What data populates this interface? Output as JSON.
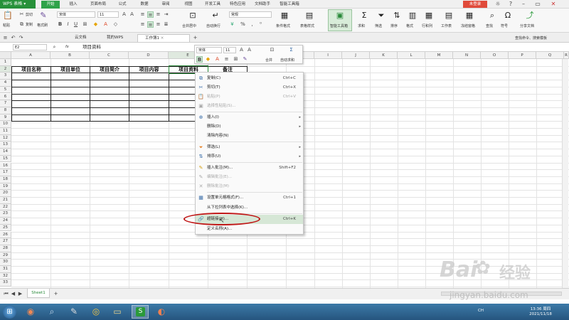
{
  "titlebar": {
    "app_name": "WPS 表格",
    "tabs": [
      "开始",
      "插入",
      "页面布局",
      "公式",
      "数据",
      "审阅",
      "视图",
      "开发工具",
      "特色应用",
      "文档助手",
      "智能工具箱"
    ],
    "active_tab": "开始",
    "login": "未登录"
  },
  "ribbon": {
    "cut": "剪切",
    "copy": "复制",
    "paste": "粘贴",
    "format_painter": "格式刷",
    "font_name": "宋体",
    "font_size": "11",
    "merge_center": "合并居中",
    "wrap_text": "自动换行",
    "number_format": "常规",
    "percent": "%",
    "cond_format": "条件格式",
    "table_style": "表格样式",
    "smart_toolbox": "智能工具箱",
    "sum": "求和",
    "filter": "筛选",
    "sort": "排序",
    "format": "格式",
    "row_col": "行和列",
    "worksheet": "工作表",
    "freeze": "冻结窗格",
    "find": "查找",
    "symbol": "符号",
    "share": "分享文档",
    "command_search": "查找命令、搜索模板"
  },
  "doctabs": {
    "tabs": [
      "云文档",
      "我的WPS",
      "工作簿1"
    ],
    "active": "工作簿1"
  },
  "formula_bar": {
    "cell_ref": "E2",
    "fx": "fx",
    "content": "项目资料"
  },
  "grid": {
    "columns": [
      "A",
      "B",
      "C",
      "D",
      "E",
      "F",
      "G",
      "H",
      "I",
      "J",
      "K",
      "L",
      "M",
      "N",
      "O",
      "P",
      "Q",
      "R"
    ],
    "rows": [
      "1",
      "2",
      "3",
      "4",
      "5",
      "6",
      "7",
      "8",
      "9",
      "10",
      "11",
      "12",
      "13",
      "14",
      "15",
      "16",
      "17",
      "18",
      "19",
      "20",
      "21",
      "22",
      "23",
      "24",
      "25",
      "26",
      "27",
      "28",
      "29",
      "30",
      "31",
      "32",
      "33"
    ],
    "headers": [
      "项目名称",
      "项目单位",
      "项目简介",
      "项目内容",
      "项目资料",
      "备注"
    ]
  },
  "minibar": {
    "font_name": "宋体",
    "font_size": "11",
    "merge": "合并",
    "autosum": "自动求和"
  },
  "context_menu": {
    "items": [
      {
        "label": "复制(C)",
        "shortcut": "Ctrl+C",
        "icon": "copy-icon",
        "disabled": false
      },
      {
        "label": "剪切(T)",
        "shortcut": "Ctrl+X",
        "icon": "cut-icon",
        "disabled": false
      },
      {
        "label": "粘贴(P)",
        "shortcut": "Ctrl+V",
        "icon": "paste-icon",
        "disabled": true
      },
      {
        "label": "选择性粘贴(S)...",
        "shortcut": "",
        "icon": "paste-special-icon",
        "disabled": true
      },
      {
        "label": "插入(I)",
        "shortcut": "",
        "icon": "insert-icon",
        "disabled": false,
        "submenu": true
      },
      {
        "label": "删除(D)",
        "shortcut": "",
        "icon": "",
        "disabled": false,
        "submenu": true
      },
      {
        "label": "清除内容(N)",
        "shortcut": "",
        "icon": "",
        "disabled": false
      },
      {
        "label": "筛选(L)",
        "shortcut": "",
        "icon": "filter-icon",
        "disabled": false,
        "submenu": true
      },
      {
        "label": "排序(U)",
        "shortcut": "",
        "icon": "sort-icon",
        "disabled": false,
        "submenu": true
      },
      {
        "label": "插入批注(M)...",
        "shortcut": "Shift+F2",
        "icon": "comment-icon",
        "disabled": false
      },
      {
        "label": "编辑批注(E)...",
        "shortcut": "",
        "icon": "edit-comment-icon",
        "disabled": true
      },
      {
        "label": "删除批注(M)",
        "shortcut": "",
        "icon": "delete-comment-icon",
        "disabled": true
      },
      {
        "label": "设置单元格格式(F)...",
        "shortcut": "Ctrl+1",
        "icon": "format-cells-icon",
        "disabled": false
      },
      {
        "label": "从下拉列表中选择(K)...",
        "shortcut": "",
        "icon": "",
        "disabled": false
      },
      {
        "label": "超链接(H)...",
        "shortcut": "Ctrl+K",
        "icon": "hyperlink-icon",
        "disabled": false,
        "highlighted": true
      },
      {
        "label": "定义名称(A)...",
        "shortcut": "",
        "icon": "",
        "disabled": false
      }
    ]
  },
  "sheet_tabs": {
    "active": "Sheet1",
    "add": "+"
  },
  "taskbar": {
    "lang": "CH",
    "time": "13:36 周四",
    "date": "2021/11/18"
  },
  "watermark": {
    "brand": "Bai",
    "brand2": "经验",
    "url": "jingyan.baidu.com"
  }
}
